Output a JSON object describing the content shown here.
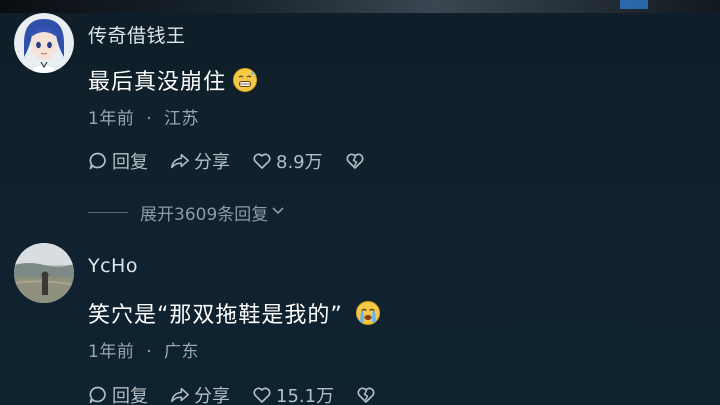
{
  "comments": [
    {
      "username": "传奇借钱王",
      "content": "最后真没崩住",
      "emoji": "grimace-emoji",
      "time": "1年前",
      "location": "江苏",
      "reply_label": "回复",
      "share_label": "分享",
      "likes": "8.9万"
    },
    {
      "username": "YcHo",
      "content": "笑穴是“那双拖鞋是我的”",
      "emoji": "crying-emoji",
      "time": "1年前",
      "location": "广东",
      "reply_label": "回复",
      "share_label": "分享",
      "likes": "15.1万"
    }
  ],
  "expand_replies": {
    "label": "展开3609条回复"
  },
  "meta_separator": "·",
  "icons": {
    "reply": "comment-bubble-icon",
    "share": "share-arrow-icon",
    "like": "heart-icon",
    "dislike": "broken-heart-icon",
    "expand": "chevron-down-icon"
  },
  "colors": {
    "background": "#0f1e28",
    "primary_text": "#ffffff",
    "secondary_text": "#9aa6ad"
  }
}
